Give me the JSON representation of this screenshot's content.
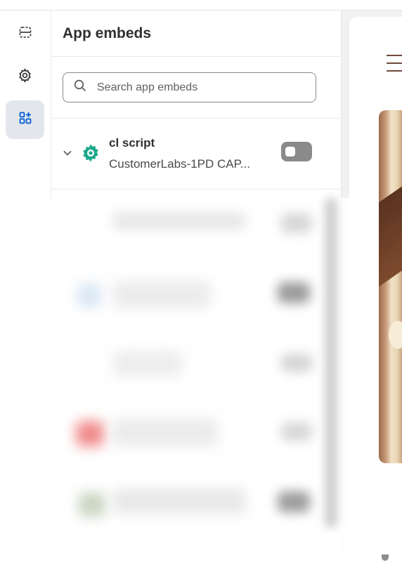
{
  "left_rail": {
    "items": [
      {
        "icon": "sections-icon",
        "active": false
      },
      {
        "icon": "gear-icon",
        "active": false
      },
      {
        "icon": "apps-add-icon",
        "active": true
      }
    ]
  },
  "panel": {
    "title": "App embeds",
    "search": {
      "placeholder": "Search app embeds",
      "value": ""
    },
    "embeds": [
      {
        "name": "cl script",
        "subtitle": "CustomerLabs-1PD CAP...",
        "icon": "gear-badge-icon",
        "icon_color": "#1aa88b",
        "enabled": false,
        "expanded": false
      }
    ]
  },
  "colors": {
    "accent": "#005bd3",
    "toggle_off": "#8a8a8a",
    "brand_brown": "#6d4a3b"
  }
}
